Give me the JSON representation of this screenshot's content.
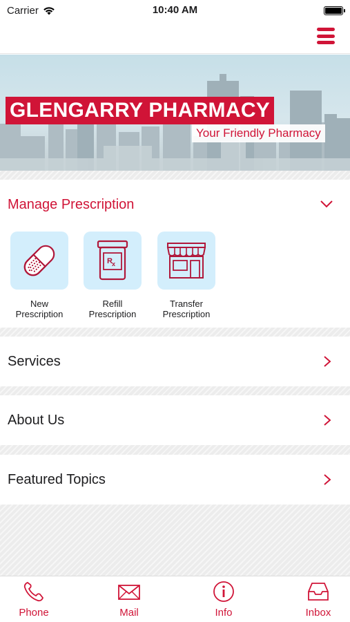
{
  "status_bar": {
    "carrier": "Carrier",
    "time": "10:40 AM"
  },
  "banner": {
    "title": "GLENGARRY PHARMACY",
    "subtitle": "Your Friendly Pharmacy"
  },
  "manage_prescription": {
    "header": "Manage Prescription",
    "tiles": [
      {
        "line1": "New",
        "line2": "Prescription",
        "icon": "pill-capsule-icon"
      },
      {
        "line1": "Refill",
        "line2": "Prescription",
        "icon": "rx-bottle-icon"
      },
      {
        "line1": "Transfer",
        "line2": "Prescription",
        "icon": "storefront-icon"
      }
    ]
  },
  "rows": [
    {
      "label": "Services"
    },
    {
      "label": "About Us"
    },
    {
      "label": "Featured Topics"
    }
  ],
  "tab_bar": [
    {
      "label": "Phone",
      "icon": "phone-icon"
    },
    {
      "label": "Mail",
      "icon": "mail-icon"
    },
    {
      "label": "Info",
      "icon": "info-icon"
    },
    {
      "label": "Inbox",
      "icon": "inbox-icon"
    }
  ],
  "colors": {
    "accent": "#d01437",
    "tile_bg": "#d3eefc",
    "stripe_bg": "#ececec"
  }
}
